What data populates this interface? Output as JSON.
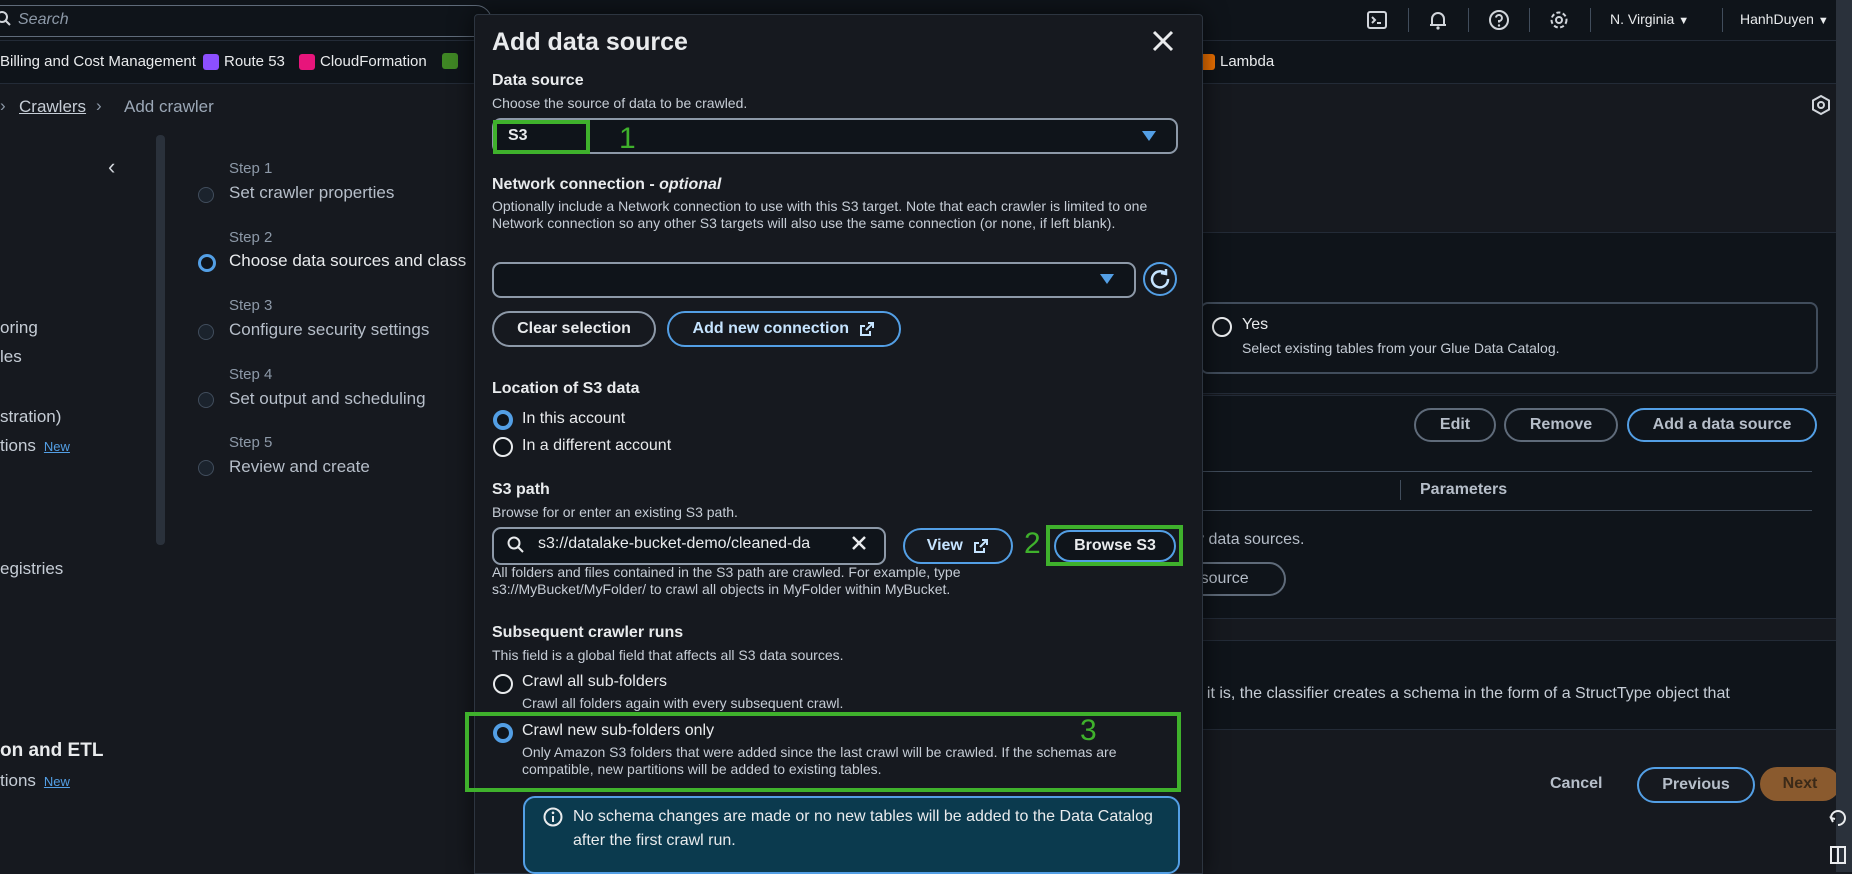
{
  "topbar": {
    "search_placeholder": "Search",
    "region": "N. Virginia",
    "user": "HanhDuyen"
  },
  "favorites": [
    {
      "label": "Billing and Cost Management",
      "color": ""
    },
    {
      "label": "Route 53",
      "color": "#8c4fff"
    },
    {
      "label": "CloudFormation",
      "color": "#e7157b"
    },
    {
      "label": "Lambda",
      "color": "#ed7100"
    }
  ],
  "breadcrumb": {
    "link": "Crawlers",
    "current": "Add crawler"
  },
  "left_nav": {
    "fragments": [
      "oring",
      "les",
      "stration)",
      "tions",
      "egistries",
      "tions"
    ],
    "new_badge": "New",
    "heading": "on and ETL"
  },
  "steps": [
    {
      "label": "Step 1",
      "title": "Set crawler properties"
    },
    {
      "label": "Step 2",
      "title": "Choose data sources and class"
    },
    {
      "label": "Step 3",
      "title": "Configure security settings"
    },
    {
      "label": "Step 4",
      "title": "Set output and scheduling"
    },
    {
      "label": "Step 5",
      "title": "Review and create"
    }
  ],
  "background": {
    "yes_label": "Yes",
    "yes_desc": "Select existing tables from your Glue Data Catalog.",
    "edit": "Edit",
    "remove": "Remove",
    "add_data_source": "Add a data source",
    "parameters": "Parameters",
    "data_sources_fragment": "y data sources.",
    "source_btn_fragment": "a source",
    "classifier_fragment": "f it is, the classifier creates a schema in the form of a StructType object that",
    "cancel": "Cancel",
    "previous": "Previous",
    "next": "Next"
  },
  "modal": {
    "title": "Add data source",
    "data_source": {
      "label": "Data source",
      "desc": "Choose the source of data to be crawled.",
      "value": "S3",
      "annotation": "1"
    },
    "network": {
      "label": "Network connection",
      "optional": "optional",
      "desc": "Optionally include a Network connection to use with this S3 target. Note that each crawler is limited to one Network connection so any other S3 targets will also use the same connection (or none, if left blank).",
      "clear": "Clear selection",
      "add": "Add new connection"
    },
    "location": {
      "label": "Location of S3 data",
      "options": [
        "In this account",
        "In a different account"
      ],
      "selected": 0
    },
    "s3_path": {
      "label": "S3 path",
      "desc": "Browse for or enter an existing S3 path.",
      "value": "s3://datalake-bucket-demo/cleaned-da",
      "view": "View",
      "browse": "Browse S3",
      "annotation": "2",
      "help": "All folders and files contained in the S3 path are crawled. For example, type s3://MyBucket/MyFolder/ to crawl all objects in MyFolder within MyBucket."
    },
    "subsequent": {
      "label": "Subsequent crawler runs",
      "desc": "This field is a global field that affects all S3 data sources.",
      "option1_label": "Crawl all sub-folders",
      "option1_desc": "Crawl all folders again with every subsequent crawl.",
      "option2_label": "Crawl new sub-folders only",
      "option2_desc": "Only Amazon S3 folders that were added since the last crawl will be crawled. If the schemas are compatible, new partitions will be added to existing tables.",
      "annotation": "3",
      "info": "No schema changes are made or no new tables will be added to the Data Catalog after the first crawl run."
    }
  }
}
